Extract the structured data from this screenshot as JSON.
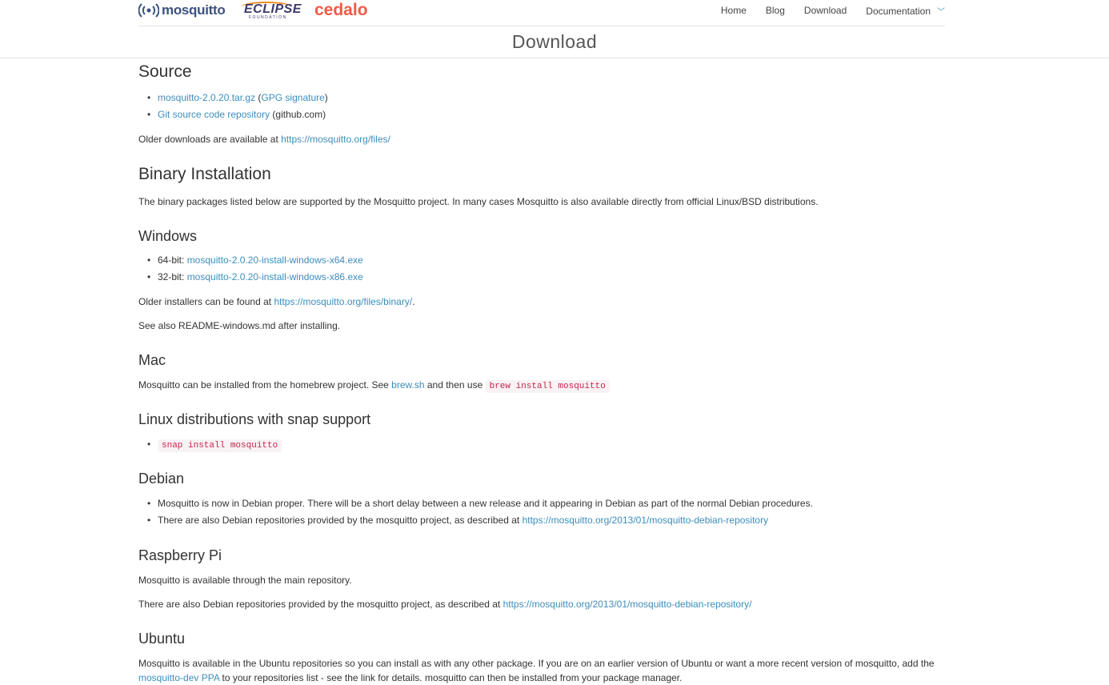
{
  "header": {
    "logo_text": "mosquitto",
    "eclipse_text": "ECLIPSE",
    "eclipse_sub": "FOUNDATION",
    "cedalo_text": "cedalo",
    "nav": [
      "Home",
      "Blog",
      "Download",
      "Documentation"
    ]
  },
  "page_title": "Download",
  "source": {
    "heading": "Source",
    "tar_link": "mosquitto-2.0.20.tar.gz",
    "gpg_open": " (",
    "gpg_link": "GPG signature",
    "gpg_close": ")",
    "git_link": "Git source code repository",
    "git_suffix": " (github.com)",
    "older_text": "Older downloads are available at ",
    "older_link": "https://mosquitto.org/files/"
  },
  "binary": {
    "heading": "Binary Installation",
    "text": "The binary packages listed below are supported by the Mosquitto project. In many cases Mosquitto is also available directly from official Linux/BSD distributions."
  },
  "windows": {
    "heading": "Windows",
    "x64_label": "64-bit: ",
    "x64_link": "mosquitto-2.0.20-install-windows-x64.exe",
    "x86_label": "32-bit: ",
    "x86_link": "mosquitto-2.0.20-install-windows-x86.exe",
    "older_text": "Older installers can be found at ",
    "older_link": "https://mosquitto.org/files/binary/",
    "older_end": ".",
    "readme": "See also README-windows.md after installing."
  },
  "mac": {
    "heading": "Mac",
    "text1": "Mosquitto can be installed from the homebrew project. See ",
    "link": "brew.sh",
    "text2": " and then use ",
    "code": "brew install mosquitto"
  },
  "snap": {
    "heading": "Linux distributions with snap support",
    "code": "snap install mosquitto"
  },
  "debian": {
    "heading": "Debian",
    "item1": "Mosquitto is now in Debian proper. There will be a short delay between a new release and it appearing in Debian as part of the normal Debian procedures.",
    "item2_text": "There are also Debian repositories provided by the mosquitto project, as described at ",
    "item2_link": "https://mosquitto.org/2013/01/mosquitto-debian-repository"
  },
  "raspberry": {
    "heading": "Raspberry Pi",
    "text1": "Mosquitto is available through the main repository.",
    "text2": "There are also Debian repositories provided by the mosquitto project, as described at ",
    "link": "https://mosquitto.org/2013/01/mosquitto-debian-repository/"
  },
  "ubuntu": {
    "heading": "Ubuntu",
    "text1": "Mosquitto is available in the Ubuntu repositories so you can install as with any other package. If you are on an earlier version of Ubuntu or want a more recent version of mosquitto, add the",
    "link": "mosquitto-dev PPA",
    "text2": " to your repositories list - see the link for details. mosquitto can then be installed from your package manager."
  }
}
